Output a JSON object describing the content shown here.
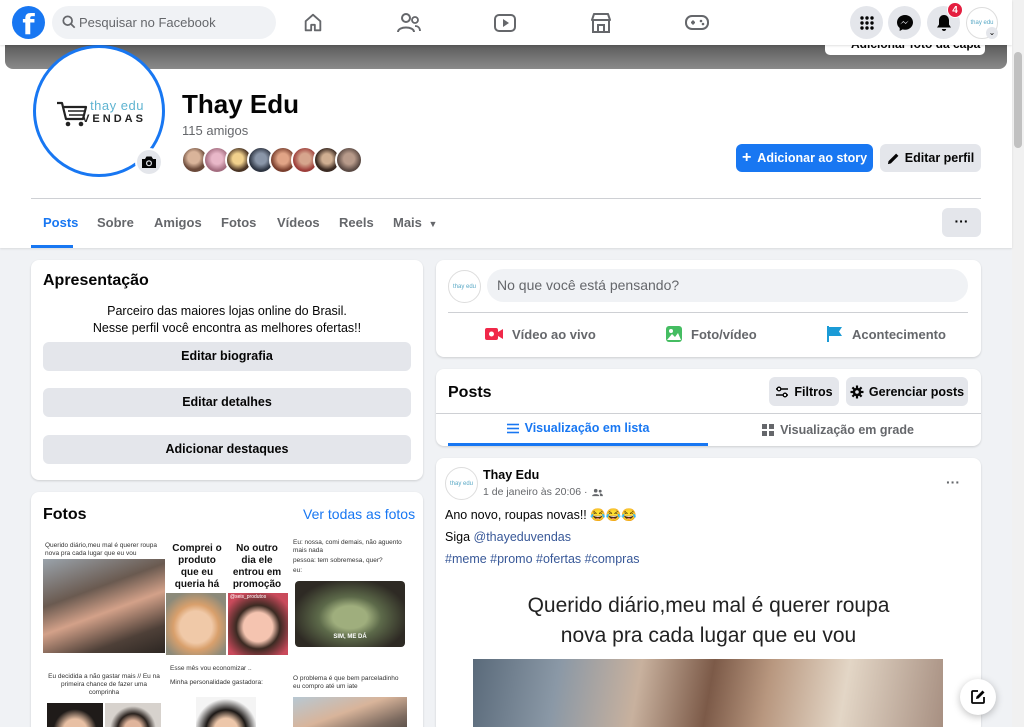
{
  "topnav": {
    "logo_glyph": "f",
    "search_placeholder": "Pesquisar no Facebook",
    "icons": [
      "home-icon",
      "friends-icon",
      "watch-icon",
      "marketplace-icon",
      "gaming-icon"
    ],
    "right_icons": [
      "menu-grid-icon",
      "messenger-icon",
      "bell-icon"
    ],
    "notification_count": "4",
    "account_avatar_text": "thay edu"
  },
  "profile": {
    "cover_button": "Adicionar foto da capa",
    "brand_line1": "thay edu",
    "brand_line2": "VENDAS",
    "name": "Thay Edu",
    "friends": "115 amigos",
    "add_story": "Adicionar ao story",
    "edit_profile": "Editar perfil",
    "tabs": [
      "Posts",
      "Sobre",
      "Amigos",
      "Fotos",
      "Vídeos",
      "Reels",
      "Mais"
    ],
    "more_dots": "···"
  },
  "intro": {
    "title": "Apresentação",
    "bio_line1": "Parceiro das maiores lojas online do Brasil.",
    "bio_line2": "Nesse perfil você encontra as melhores ofertas!!",
    "btn_bio": "Editar biografia",
    "btn_details": "Editar detalhes",
    "btn_highlights": "Adicionar destaques"
  },
  "photos": {
    "title": "Fotos",
    "see_all": "Ver todas as fotos",
    "p1_text": "Querido diário,meu mal é querer roupa nova pra cada lugar que eu vou",
    "p2_left": "Comprei o produto que eu queria há meses",
    "p2_right": "No outro dia ele entrou em promoção",
    "p2_handle": "@seis_produtos",
    "p3_text1": "Eu: nossa, comi demais, não aguento mais nada",
    "p3_text2": "pessoa: tem sobremesa, quer?",
    "p3_text3": "eu:",
    "p3_caption": "SIM, ME DÁ",
    "p4_text": "Eu decidida a não gastar mais // Eu na primeira chance de fazer uma comprinha",
    "p5_text1": "Esse mês vou economizar ..",
    "p5_text2": "Minha personalidade gastadora:",
    "p6_text": "O problema é que bem parceladinho eu compro até um iate"
  },
  "composer": {
    "placeholder": "No que você está pensando?",
    "live": "Vídeo ao vivo",
    "photo": "Foto/vídeo",
    "event": "Acontecimento"
  },
  "posts_header": {
    "title": "Posts",
    "filters": "Filtros",
    "manage": "Gerenciar posts",
    "list_view": "Visualização em lista",
    "grid_view": "Visualização em grade"
  },
  "post": {
    "author": "Thay Edu",
    "date": "1 de janeiro às 20:06 ·",
    "line1": "Ano novo, roupas novas!! 😂😂😂",
    "line2_prefix": "Siga ",
    "line2_handle": "@thayeduvendas",
    "hashtags": "#meme #promo #ofertas #compras",
    "caption_line1": "Querido diário,meu mal é querer roupa",
    "caption_line2": "nova pra cada lugar que eu vou",
    "menu_dots": "···"
  },
  "colors": {
    "brand_blue": "#1877f2",
    "background": "#f0f2f5",
    "secondary_button": "#e4e6eb",
    "secondary_text": "#65676b",
    "badge_red": "#e41e3f"
  }
}
